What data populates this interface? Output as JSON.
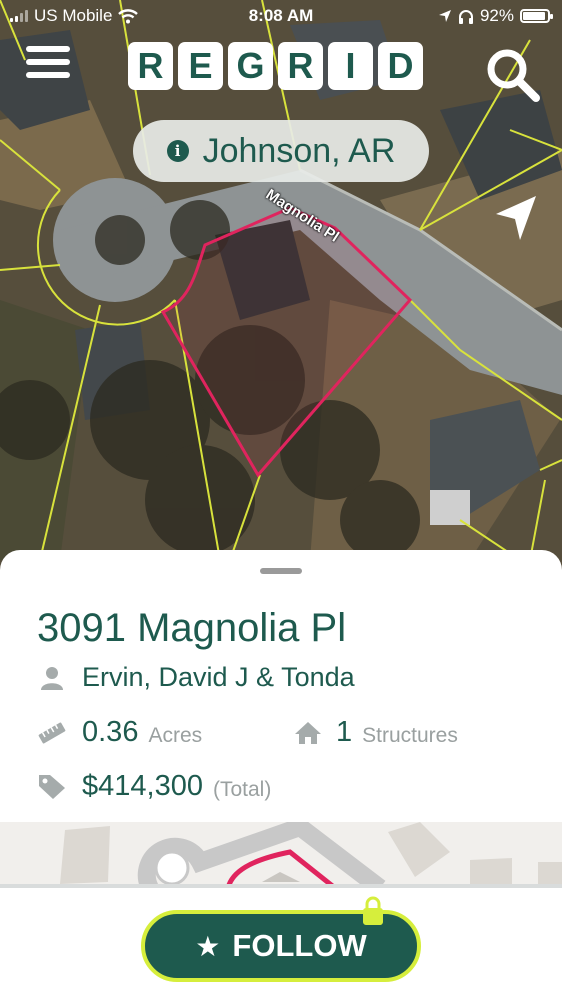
{
  "status_bar": {
    "carrier": "US Mobile",
    "time": "8:08 AM",
    "battery": "92%"
  },
  "header": {
    "logo_letters": [
      "R",
      "E",
      "G",
      "R",
      "I",
      "D"
    ],
    "menu_icon": "hamburger-menu-icon",
    "search_icon": "search-icon"
  },
  "map": {
    "location": "Johnson, AR",
    "street_label": "Magnolia Pl",
    "nav_icon": "navigation-arrow-icon",
    "parcel_outline_color": "#e0245e",
    "parcel_lines_color": "#d8e23c"
  },
  "parcel": {
    "address": "3091 Magnolia Pl",
    "owner": "Ervin, David J & Tonda",
    "acres_value": "0.36",
    "acres_unit": "Acres",
    "structures_value": "1",
    "structures_unit": "Structures",
    "total_value": "$414,300",
    "total_unit": "(Total)"
  },
  "actions": {
    "follow_label": "FOLLOW",
    "follow_icon": "star-icon",
    "lock_icon": "lock-icon"
  },
  "colors": {
    "brand": "#1e5a4e",
    "accent": "#d6ee3c"
  }
}
